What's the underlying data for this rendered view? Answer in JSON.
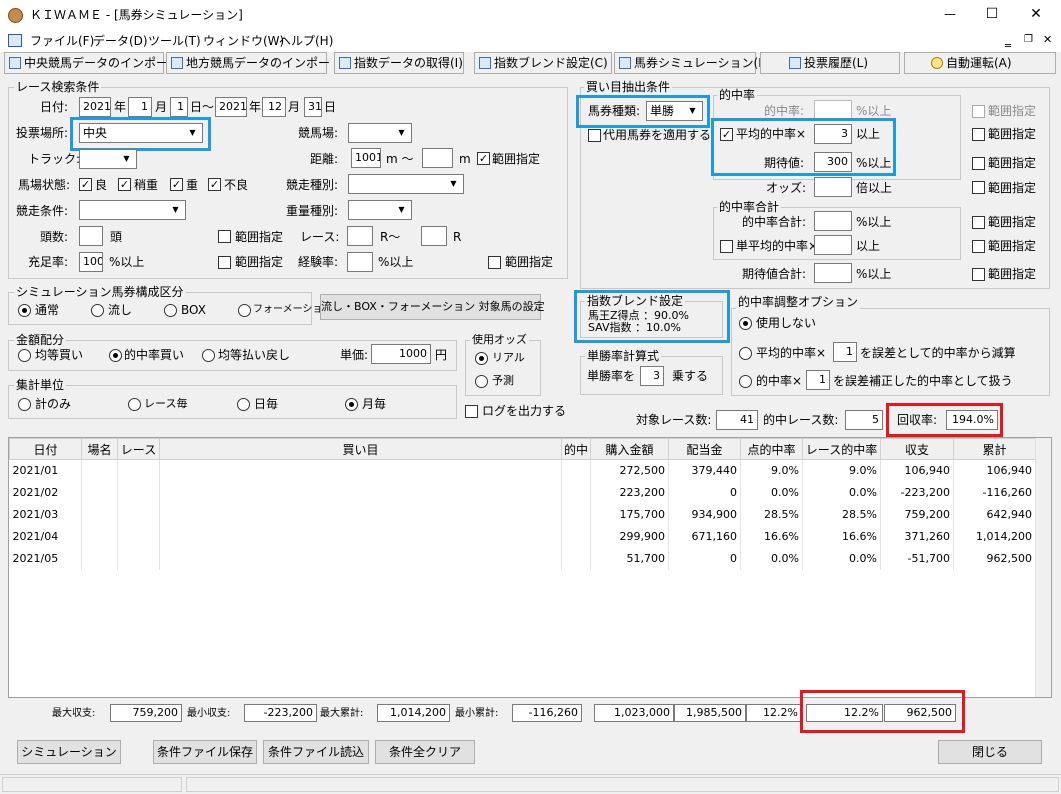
{
  "window": {
    "title": "ＫＩＷＡＭＥ - [馬券シミュレーション]",
    "minimize": "—",
    "maximize": "☐",
    "close": "✕"
  },
  "menu": [
    "ファイル(F)",
    "データ(D)",
    "ツール(T)",
    "ウィンドウ(W)",
    "ヘルプ(H)"
  ],
  "toolbar": [
    "中央競馬データのインポート(J)",
    "地方競馬データのインポート(N)",
    "指数データの取得(I)",
    "指数ブレンド設定(C)",
    "馬券シミュレーション(B)",
    "投票履歴(L)",
    "自動運転(A)"
  ],
  "race": {
    "group": "レース検索条件",
    "date_label": "日付:",
    "from_year": "2021",
    "from_month": "1",
    "from_day": "1",
    "to_year": "2021",
    "to_month": "12",
    "to_day": "31",
    "year": "年",
    "month": "月",
    "day": "日",
    "tilde": "日～",
    "venue_label": "投票場所:",
    "venue": "中央",
    "course_label": "競馬場:",
    "track_label": "トラック:",
    "distance_label": "距離:",
    "distance_from": "1001",
    "distance_unit": "m",
    "wave": "m ～",
    "range": "範囲指定",
    "cond_label": "馬場状態:",
    "conds": [
      "良",
      "稍重",
      "重",
      "不良"
    ],
    "rtype_label": "競走種別:",
    "rcond_label": "競走条件:",
    "weight_label": "重量種別:",
    "heads_label": "頭数:",
    "heads_unit": "頭",
    "race_label": "レース:",
    "race_unit1": "R～",
    "race_unit2": "R",
    "fill_label": "充足率:",
    "fill": "100",
    "fill_unit": "%以上",
    "exp_label": "経験率:",
    "exp_unit": "%以上"
  },
  "sim": {
    "group": "シミュレーション馬券構成区分",
    "types": [
      "通常",
      "流し",
      "BOX",
      "フォーメーション"
    ],
    "button": "流し・BOX・フォーメーション 対象馬の設定"
  },
  "amount": {
    "group": "金額配分",
    "types": [
      "均等買い",
      "的中率買い",
      "均等払い戻し"
    ],
    "unit_label": "単価:",
    "unit_value": "1000",
    "yen": "円"
  },
  "odds": {
    "group": "使用オッズ",
    "types": [
      "リアル",
      "予測"
    ]
  },
  "agg": {
    "group": "集計単位",
    "types": [
      "計のみ",
      "レース毎",
      "日毎",
      "月毎"
    ]
  },
  "log_label": "ログを出力する",
  "buy": {
    "group": "買い目抽出条件",
    "kind_label": "馬券種類:",
    "kind": "単勝",
    "substitute": "代用馬券を適用する",
    "hit_group": "的中率",
    "hit_label": "的中率:",
    "hit_unit": "%以上",
    "avg_label": "平均的中率×",
    "avg_value": "3",
    "avg_unit": "以上",
    "ev_label": "期待値:",
    "ev_value": "300",
    "ev_unit": "%以上",
    "odds_label": "オッズ:",
    "odds_unit": "倍以上",
    "sum_group": "的中率合計",
    "sum_label": "的中率合計:",
    "sum_unit": "%以上",
    "single_label": "単平均的中率×",
    "single_unit": "以上",
    "evsum_label": "期待値合計:",
    "evsum_unit": "%以上",
    "range": "範囲指定"
  },
  "blend": {
    "group": "指数ブレンド設定",
    "line1": "馬王Z得点 ：90.0%",
    "line2": "SAV指数 ：10.0%"
  },
  "formula": {
    "group": "単勝率計算式",
    "label": "単勝率を",
    "value": "3",
    "unit": "乗する"
  },
  "adjust": {
    "group": "的中率調整オプション",
    "opt1": "使用しない",
    "opt2a": "平均的中率×",
    "opt2v": "1",
    "opt2b": "を誤差として的中率から減算",
    "opt3a": "的中率×",
    "opt3v": "1",
    "opt3b": "を誤差補正した的中率として扱う"
  },
  "stats": {
    "races_label": "対象レース数:",
    "races": "41",
    "hits_label": "的中レース数:",
    "hits": "5",
    "recovery_label": "回収率:",
    "recovery": "194.0%"
  },
  "table": {
    "headers": [
      "日付",
      "場名",
      "レース",
      "買い目",
      "的中",
      "購入金額",
      "配当金",
      "点的中率",
      "レース的中率",
      "収支",
      "累計"
    ],
    "rows": [
      [
        "2021/01",
        "",
        "",
        "",
        "",
        "272,500",
        "379,440",
        "9.0%",
        "9.0%",
        "106,940",
        "106,940"
      ],
      [
        "2021/02",
        "",
        "",
        "",
        "",
        "223,200",
        "0",
        "0.0%",
        "0.0%",
        "-223,200",
        "-116,260"
      ],
      [
        "2021/03",
        "",
        "",
        "",
        "",
        "175,700",
        "934,900",
        "28.5%",
        "28.5%",
        "759,200",
        "642,940"
      ],
      [
        "2021/04",
        "",
        "",
        "",
        "",
        "299,900",
        "671,160",
        "16.6%",
        "16.6%",
        "371,260",
        "1,014,200"
      ],
      [
        "2021/05",
        "",
        "",
        "",
        "",
        "51,700",
        "0",
        "0.0%",
        "0.0%",
        "-51,700",
        "962,500"
      ]
    ]
  },
  "footer": {
    "max_label": "最大収支:",
    "max": "759,200",
    "min_label": "最小収支:",
    "min": "-223,200",
    "maxc_label": "最大累計:",
    "maxc": "1,014,200",
    "minc_label": "最小累計:",
    "minc": "-116,260",
    "purchase": "1,023,000",
    "payout": "1,985,500",
    "pt_rate": "12.2%",
    "race_rate": "12.2%",
    "total": "962,500"
  },
  "buttons": {
    "simulate": "シミュレーション",
    "save": "条件ファイル保存",
    "load": "条件ファイル読込",
    "clear": "条件全クリア",
    "close": "閉じる"
  },
  "colors": {
    "highlight_blue": "#1e9be0",
    "highlight_red": "#e5171f"
  }
}
